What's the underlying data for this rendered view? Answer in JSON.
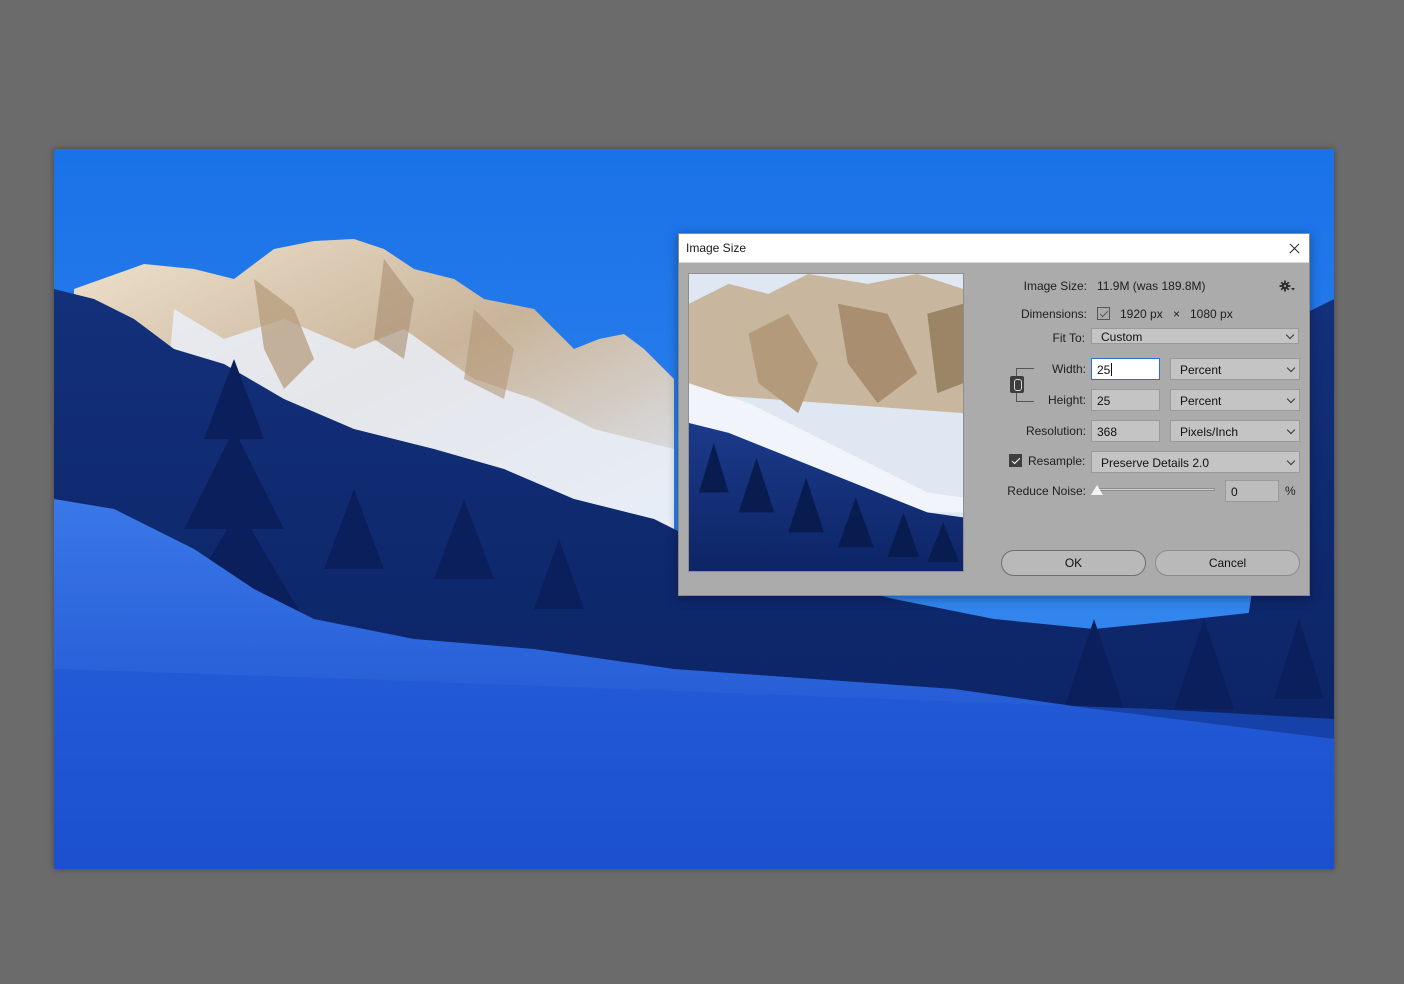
{
  "dialog": {
    "title": "Image Size",
    "image_size": {
      "label": "Image Size:",
      "value": "11.9M (was 189.8M)"
    },
    "dimensions": {
      "label": "Dimensions:",
      "width": "1920 px",
      "times": "×",
      "height": "1080 px"
    },
    "fit_to": {
      "label": "Fit To:",
      "value": "Custom"
    },
    "width": {
      "label": "Width:",
      "value": "25",
      "unit": "Percent"
    },
    "height": {
      "label": "Height:",
      "value": "25",
      "unit": "Percent"
    },
    "resolution": {
      "label": "Resolution:",
      "value": "368",
      "unit": "Pixels/Inch"
    },
    "resample": {
      "label": "Resample:",
      "value": "Preserve Details 2.0",
      "checked": true
    },
    "reduce_noise": {
      "label": "Reduce Noise:",
      "value": "0",
      "unit": "%",
      "level": 0
    },
    "buttons": {
      "ok": "OK",
      "cancel": "Cancel"
    }
  },
  "icons": {
    "close": "close-icon",
    "settings": "gear-icon",
    "link": "link-constrain-icon",
    "dimensions_toggle": "chevron-down-icon"
  },
  "colors": {
    "workspace": "#6b6b6b",
    "dialog_bg": "#ababab",
    "sky": "#1f6fe0",
    "active_field_border": "#2b6fd6"
  }
}
